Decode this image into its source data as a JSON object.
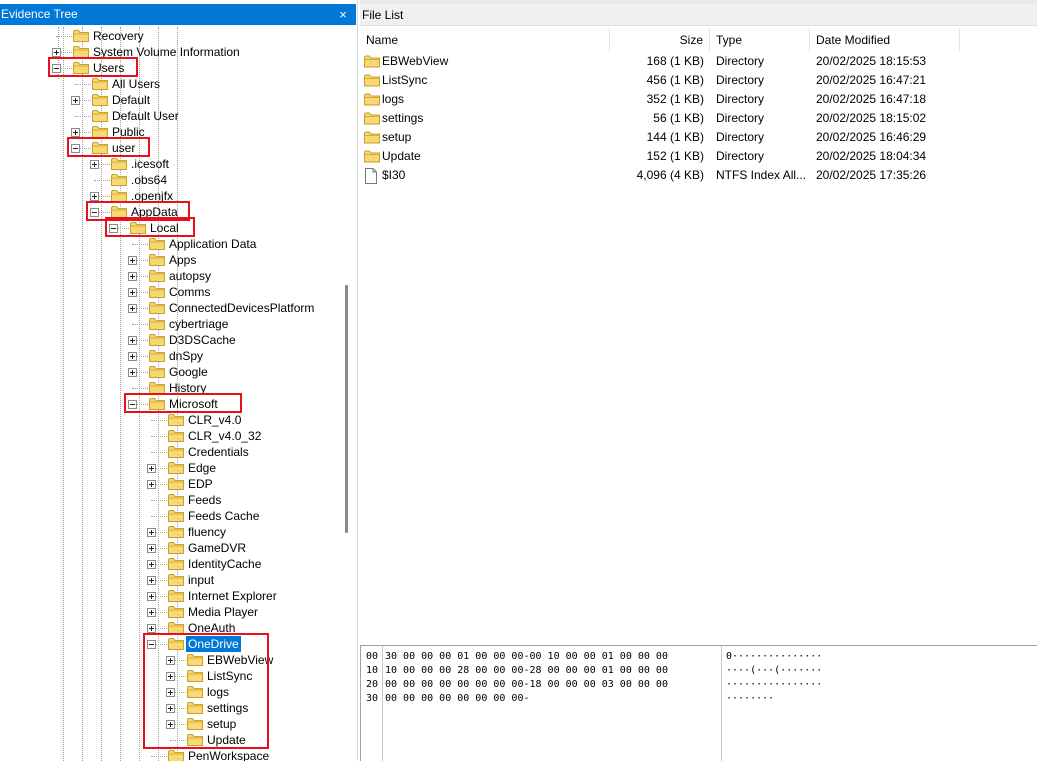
{
  "evidence_tree": {
    "title": "Evidence Tree",
    "close_glyph": "×",
    "nodes": [
      {
        "label": "Recovery",
        "level": 3,
        "expander": "none",
        "highlighted": false,
        "selected": false
      },
      {
        "label": "System Volume Information",
        "level": 3,
        "expander": "plus",
        "highlighted": false,
        "selected": false
      },
      {
        "label": "Users",
        "level": 3,
        "expander": "minus",
        "highlighted": true,
        "selected": false
      },
      {
        "label": "All Users",
        "level": 4,
        "expander": "none",
        "highlighted": false,
        "selected": false
      },
      {
        "label": "Default",
        "level": 4,
        "expander": "plus",
        "highlighted": false,
        "selected": false
      },
      {
        "label": "Default User",
        "level": 4,
        "expander": "none",
        "highlighted": false,
        "selected": false
      },
      {
        "label": "Public",
        "level": 4,
        "expander": "plus",
        "highlighted": false,
        "selected": false
      },
      {
        "label": "user",
        "level": 4,
        "expander": "minus",
        "highlighted": true,
        "selected": false
      },
      {
        "label": ".icesoft",
        "level": 5,
        "expander": "plus",
        "highlighted": false,
        "selected": false
      },
      {
        "label": ".obs64",
        "level": 5,
        "expander": "none",
        "highlighted": false,
        "selected": false
      },
      {
        "label": ".openjfx",
        "level": 5,
        "expander": "plus",
        "highlighted": false,
        "selected": false
      },
      {
        "label": "AppData",
        "level": 5,
        "expander": "minus",
        "highlighted": true,
        "selected": false
      },
      {
        "label": "Local",
        "level": 6,
        "expander": "minus",
        "highlighted": true,
        "selected": false
      },
      {
        "label": "Application Data",
        "level": 7,
        "expander": "none",
        "highlighted": false,
        "selected": false
      },
      {
        "label": "Apps",
        "level": 7,
        "expander": "plus",
        "highlighted": false,
        "selected": false
      },
      {
        "label": "autopsy",
        "level": 7,
        "expander": "plus",
        "highlighted": false,
        "selected": false
      },
      {
        "label": "Comms",
        "level": 7,
        "expander": "plus",
        "highlighted": false,
        "selected": false
      },
      {
        "label": "ConnectedDevicesPlatform",
        "level": 7,
        "expander": "plus",
        "highlighted": false,
        "selected": false
      },
      {
        "label": "cybertriage",
        "level": 7,
        "expander": "none",
        "highlighted": false,
        "selected": false
      },
      {
        "label": "D3DSCache",
        "level": 7,
        "expander": "plus",
        "highlighted": false,
        "selected": false
      },
      {
        "label": "dnSpy",
        "level": 7,
        "expander": "plus",
        "highlighted": false,
        "selected": false
      },
      {
        "label": "Google",
        "level": 7,
        "expander": "plus",
        "highlighted": false,
        "selected": false
      },
      {
        "label": "History",
        "level": 7,
        "expander": "none",
        "highlighted": false,
        "selected": false
      },
      {
        "label": "Microsoft",
        "level": 7,
        "expander": "minus",
        "highlighted": true,
        "selected": false
      },
      {
        "label": "CLR_v4.0",
        "level": 8,
        "expander": "none",
        "highlighted": false,
        "selected": false
      },
      {
        "label": "CLR_v4.0_32",
        "level": 8,
        "expander": "none",
        "highlighted": false,
        "selected": false
      },
      {
        "label": "Credentials",
        "level": 8,
        "expander": "none",
        "highlighted": false,
        "selected": false
      },
      {
        "label": "Edge",
        "level": 8,
        "expander": "plus",
        "highlighted": false,
        "selected": false
      },
      {
        "label": "EDP",
        "level": 8,
        "expander": "plus",
        "highlighted": false,
        "selected": false
      },
      {
        "label": "Feeds",
        "level": 8,
        "expander": "none",
        "highlighted": false,
        "selected": false
      },
      {
        "label": "Feeds Cache",
        "level": 8,
        "expander": "none",
        "highlighted": false,
        "selected": false
      },
      {
        "label": "fluency",
        "level": 8,
        "expander": "plus",
        "highlighted": false,
        "selected": false
      },
      {
        "label": "GameDVR",
        "level": 8,
        "expander": "plus",
        "highlighted": false,
        "selected": false
      },
      {
        "label": "IdentityCache",
        "level": 8,
        "expander": "plus",
        "highlighted": false,
        "selected": false
      },
      {
        "label": "input",
        "level": 8,
        "expander": "plus",
        "highlighted": false,
        "selected": false
      },
      {
        "label": "Internet Explorer",
        "level": 8,
        "expander": "plus",
        "highlighted": false,
        "selected": false
      },
      {
        "label": "Media Player",
        "level": 8,
        "expander": "plus",
        "highlighted": false,
        "selected": false
      },
      {
        "label": "OneAuth",
        "level": 8,
        "expander": "plus",
        "highlighted": false,
        "selected": false
      },
      {
        "label": "OneDrive",
        "level": 8,
        "expander": "minus",
        "highlighted": true,
        "selected": true
      },
      {
        "label": "EBWebView",
        "level": 9,
        "expander": "plus",
        "highlighted": false,
        "selected": false
      },
      {
        "label": "ListSync",
        "level": 9,
        "expander": "plus",
        "highlighted": false,
        "selected": false
      },
      {
        "label": "logs",
        "level": 9,
        "expander": "plus",
        "highlighted": false,
        "selected": false
      },
      {
        "label": "settings",
        "level": 9,
        "expander": "plus",
        "highlighted": false,
        "selected": false
      },
      {
        "label": "setup",
        "level": 9,
        "expander": "plus",
        "highlighted": false,
        "selected": false
      },
      {
        "label": "Update",
        "level": 9,
        "expander": "none",
        "highlighted": false,
        "selected": false
      },
      {
        "label": "PenWorkspace",
        "level": 8,
        "expander": "none",
        "highlighted": false,
        "selected": false
      }
    ]
  },
  "file_list": {
    "title": "File List",
    "columns": {
      "name": "Name",
      "size": "Size",
      "type": "Type",
      "modified": "Date Modified"
    },
    "rows": [
      {
        "icon": "folder-icon",
        "name": "EBWebView",
        "size": "168 (1 KB)",
        "type": "Directory",
        "modified": "20/02/2025 18:15:53"
      },
      {
        "icon": "folder-icon",
        "name": "ListSync",
        "size": "456 (1 KB)",
        "type": "Directory",
        "modified": "20/02/2025 16:47:21"
      },
      {
        "icon": "folder-icon",
        "name": "logs",
        "size": "352 (1 KB)",
        "type": "Directory",
        "modified": "20/02/2025 16:47:18"
      },
      {
        "icon": "folder-icon",
        "name": "settings",
        "size": "56 (1 KB)",
        "type": "Directory",
        "modified": "20/02/2025 18:15:02"
      },
      {
        "icon": "folder-icon",
        "name": "setup",
        "size": "144 (1 KB)",
        "type": "Directory",
        "modified": "20/02/2025 16:46:29"
      },
      {
        "icon": "folder-icon",
        "name": "Update",
        "size": "152 (1 KB)",
        "type": "Directory",
        "modified": "20/02/2025 18:04:34"
      },
      {
        "icon": "file-icon",
        "name": "$I30",
        "size": "4,096 (4 KB)",
        "type": "NTFS Index All...",
        "modified": "20/02/2025 17:35:26"
      }
    ]
  },
  "hex_view": {
    "rows": [
      {
        "offset": "00",
        "bytes": "30 00 00 00 01 00 00 00-00 10 00 00 01 00 00 00",
        "ascii": "0···············"
      },
      {
        "offset": "10",
        "bytes": "10 00 00 00 28 00 00 00-28 00 00 00 01 00 00 00",
        "ascii": "····(···(·······"
      },
      {
        "offset": "20",
        "bytes": "00 00 00 00 00 00 00 00-18 00 00 00 03 00 00 00",
        "ascii": "················"
      },
      {
        "offset": "30",
        "bytes": "00 00 00 00 00 00 00 00-",
        "ascii": "········"
      }
    ]
  },
  "colors": {
    "selection": "#0078d7",
    "highlight_box": "#e8101a",
    "folder_fill": "#f8d775",
    "folder_stroke": "#c9a227"
  }
}
